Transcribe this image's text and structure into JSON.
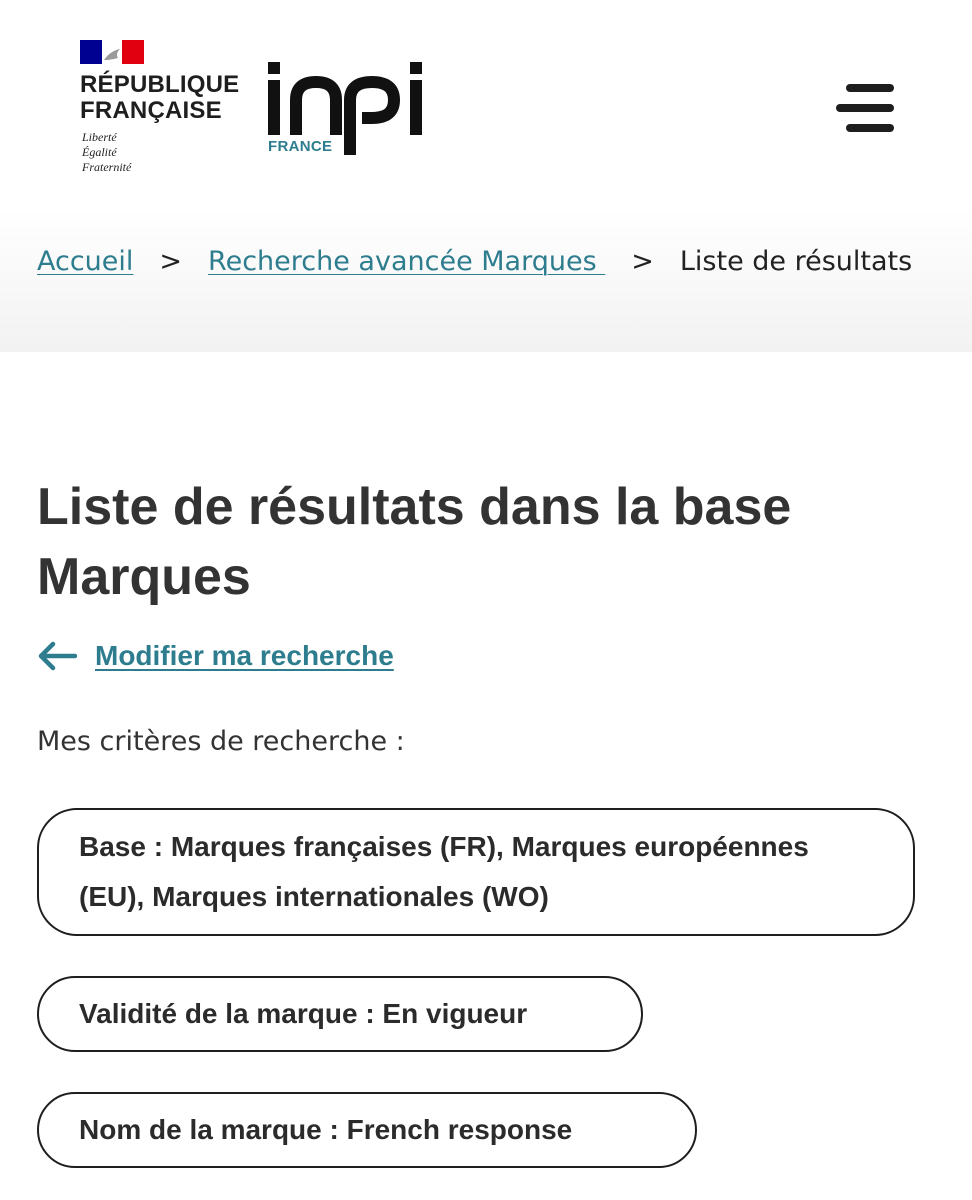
{
  "header": {
    "gov_logo": {
      "name_line1": "RÉPUBLIQUE",
      "name_line2": "FRANÇAISE",
      "motto_1": "Liberté",
      "motto_2": "Égalité",
      "motto_3": "Fraternité"
    },
    "inpi_logo": {
      "wordmark": "inpi",
      "subtitle": "FRANCE"
    },
    "menu_icon": "hamburger-menu-icon"
  },
  "breadcrumb": {
    "items": [
      {
        "label": "Accueil"
      },
      {
        "label": "Recherche avancée Marques "
      },
      {
        "label": "Liste de résultats"
      }
    ],
    "separator": ">"
  },
  "main": {
    "title": "Liste de résultats dans la base Marques",
    "back_link": "Modifier ma recherche",
    "criteria_label": "Mes critères de recherche :",
    "criteria": [
      "Base : Marques françaises (FR), Marques européennes (EU), Marques internationales (WO)",
      "Validité de la marque : En vigueur",
      "Nom de la marque : French response"
    ]
  },
  "colors": {
    "accent": "#2e7d8f",
    "text": "#2b2b2b",
    "flag_blue": "#000091",
    "flag_red": "#e1000f"
  }
}
